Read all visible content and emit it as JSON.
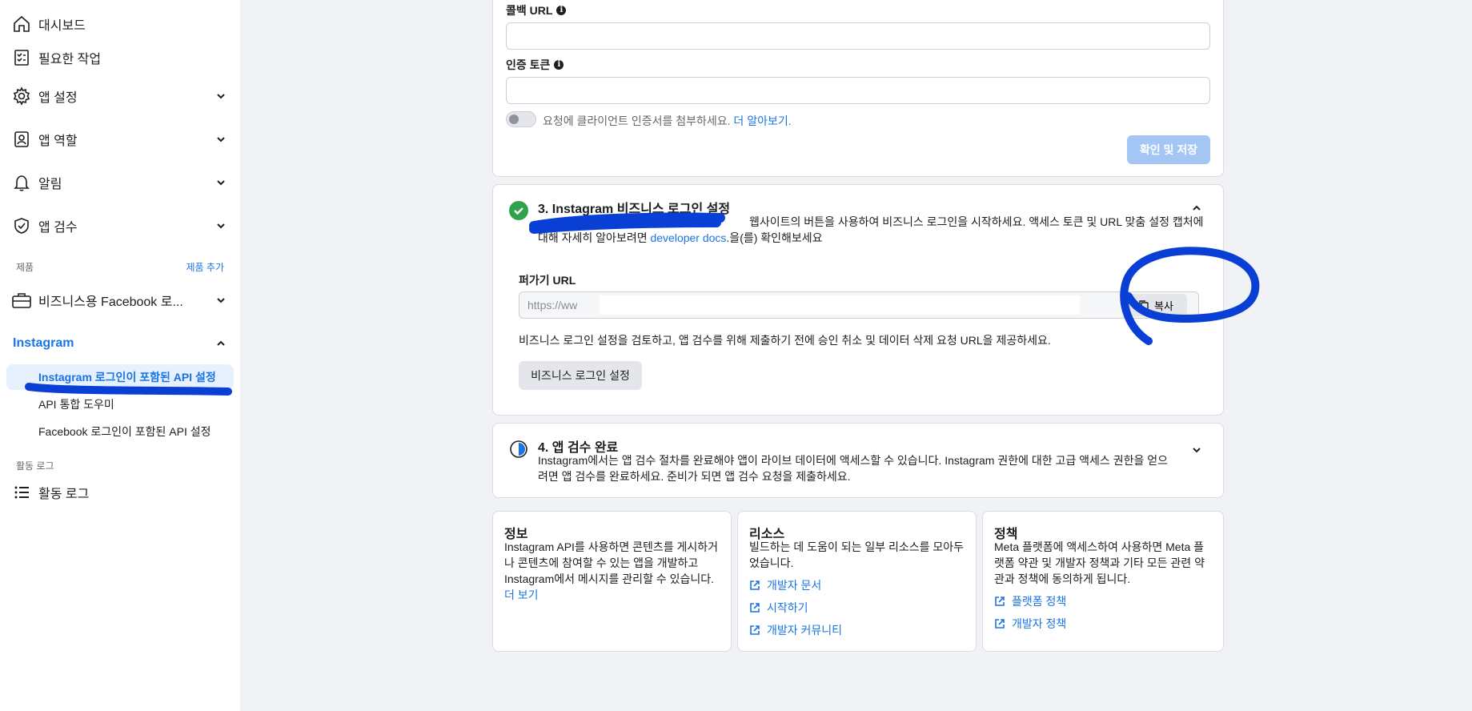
{
  "sidebar": {
    "items": [
      {
        "label": "대시보드",
        "icon": "home-icon"
      },
      {
        "label": "필요한 작업",
        "icon": "checklist-icon"
      },
      {
        "label": "앱 설정",
        "icon": "gear-icon"
      },
      {
        "label": "앱 역할",
        "icon": "id-badge-icon"
      },
      {
        "label": "알림",
        "icon": "bell-icon"
      },
      {
        "label": "앱 검수",
        "icon": "shield-check-icon"
      }
    ],
    "products_label": "제품",
    "add_product": "제품 추가",
    "business_facebook": "비즈니스용 Facebook 로...",
    "instagram_label": "Instagram",
    "instagram_subitems": [
      "Instagram 로그인이 포함된 API 설정",
      "API 통합 도우미",
      "Facebook 로그인이 포함된 API 설정"
    ],
    "activity_section": "활동 로그",
    "activity_log": "활동 로그"
  },
  "webhook_card": {
    "callback_url_label": "콜백 URL",
    "verify_token_label": "인증 토큰",
    "toggle_text": "요청에 클라이언트 인증서를 첨부하세요.",
    "learn_more": "더 알아보기",
    "save_button": "확인 및 저장"
  },
  "step3": {
    "title": "3. Instagram 비즈니스 로그인 설정",
    "desc_line1": "웹사이트의 버튼을 사용하여 비즈니스 로그인을 시작하세요. 액세스 토큰 및 URL 맞춤 설정 캡처에",
    "desc_line2_prefix": "대해 자세히 알아보려면 ",
    "desc_link": "developer docs",
    "desc_line2_suffix": ".을(를) 확인해보세요",
    "embed_url_label": "퍼가기 URL",
    "embed_url_value": "https://ww",
    "copy_button": "복사",
    "notice": "비즈니스 로그인 설정을 검토하고, 앱 검수를 위해 제출하기 전에 승인 취소 및 데이터 삭제 요청 URL을 제공하세요.",
    "settings_button": "비즈니스 로그인 설정"
  },
  "step4": {
    "title": "4. 앱 검수 완료",
    "desc": "Instagram에서는 앱 검수 절차를 완료해야 앱이 라이브 데이터에 액세스할 수 있습니다. Instagram 권한에 대한 고급 액세스 권한을 얻으려면 앱 검수를 완료하세요. 준비가 되면 앱 검수 요청을 제출하세요."
  },
  "info_card": {
    "title": "정보",
    "body": "Instagram API를 사용하면 콘텐츠를 게시하거나 콘텐츠에 참여할 수 있는 앱을 개발하고 Instagram에서 메시지를 관리할 수 있습니다.",
    "more": "더 보기"
  },
  "resources_card": {
    "title": "리소스",
    "body": "빌드하는 데 도움이 되는 일부 리소스를 모아두었습니다.",
    "links": [
      "개발자 문서",
      "시작하기",
      "개발자 커뮤니티"
    ]
  },
  "policy_card": {
    "title": "정책",
    "body": "Meta 플랫폼에 액세스하여 사용하면 Meta 플랫폼 약관 및 개발자 정책과 기타 모든 관련 약관과 정책에 동의하게 됩니다.",
    "links": [
      "플랫폼 정책",
      "개발자 정책"
    ]
  },
  "colors": {
    "accent": "#1b74e4",
    "annotation": "#0a3fd6",
    "success": "#31a24c"
  }
}
